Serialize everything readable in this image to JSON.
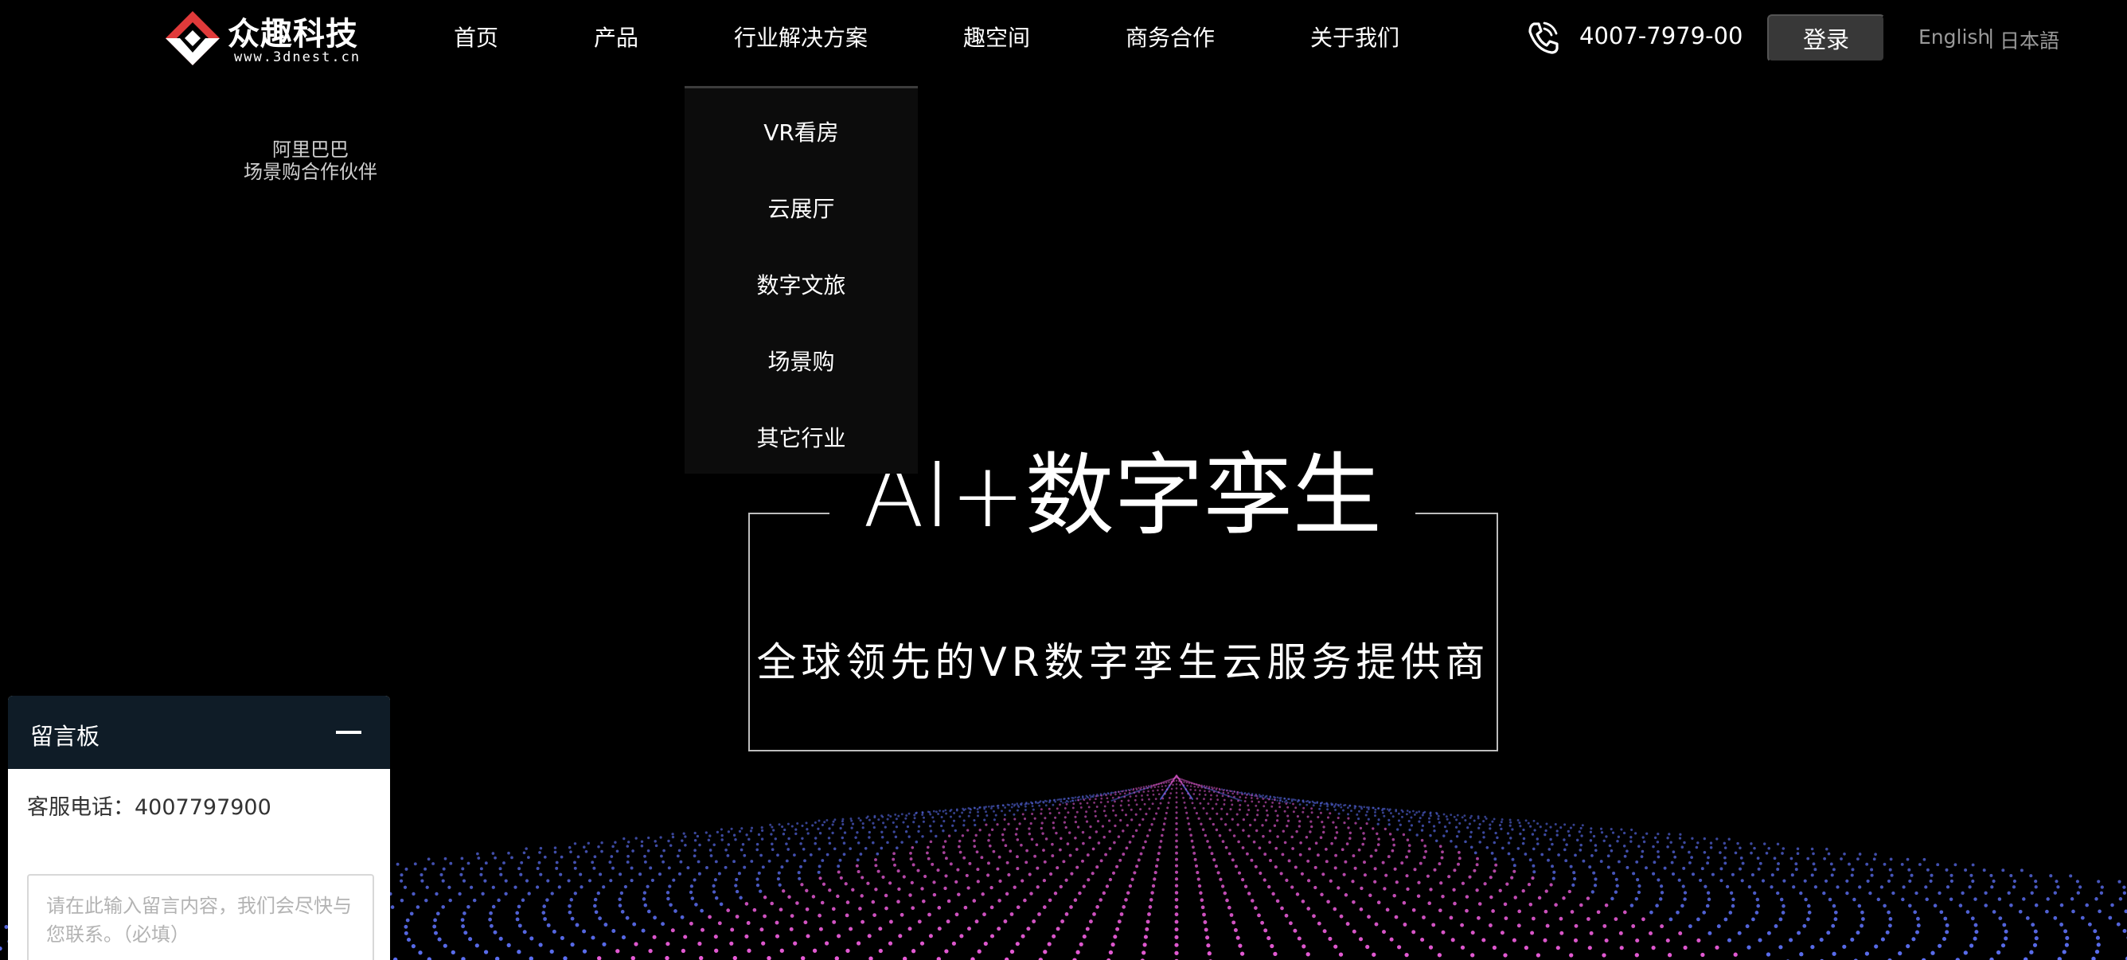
{
  "header": {
    "logo": {
      "name": "众趣科技",
      "url": "www.3dnest.cn",
      "colors": {
        "red": "#e03a3a",
        "white": "#ffffff"
      }
    },
    "nav": [
      {
        "label": "首页"
      },
      {
        "label": "产品"
      },
      {
        "label": "行业解决方案"
      },
      {
        "label": "趣空间"
      },
      {
        "label": "商务合作"
      },
      {
        "label": "关于我们"
      }
    ],
    "phone": {
      "icon": "phone-icon",
      "number": "4007-7979-00"
    },
    "login_label": "登录",
    "languages": {
      "english": "English",
      "separator": "|",
      "japanese": "日本語"
    }
  },
  "partner": {
    "line1": "阿里巴巴",
    "line2": "场景购合作伙伴"
  },
  "dropdown": {
    "items": [
      {
        "label": "VR看房"
      },
      {
        "label": "云展厅"
      },
      {
        "label": "数字文旅"
      },
      {
        "label": "场景购"
      },
      {
        "label": "其它行业"
      }
    ]
  },
  "hero": {
    "title": "AI+数字孪生",
    "subtitle": "全球领先的VR数字孪生云服务提供商"
  },
  "message_board": {
    "title": "留言板",
    "minimize_icon": "minimize-icon",
    "phone_text": "客服电话：4007797900",
    "placeholder": "请在此输入留言内容，我们会尽快与您联系。（必填）"
  },
  "colors": {
    "background": "#000000",
    "dropdown_bg": "#0c0c0c",
    "login_bg": "#383838",
    "board_header": "#0f1c27",
    "particle_near": "#e75bd6",
    "particle_far": "#5b6ef0"
  }
}
